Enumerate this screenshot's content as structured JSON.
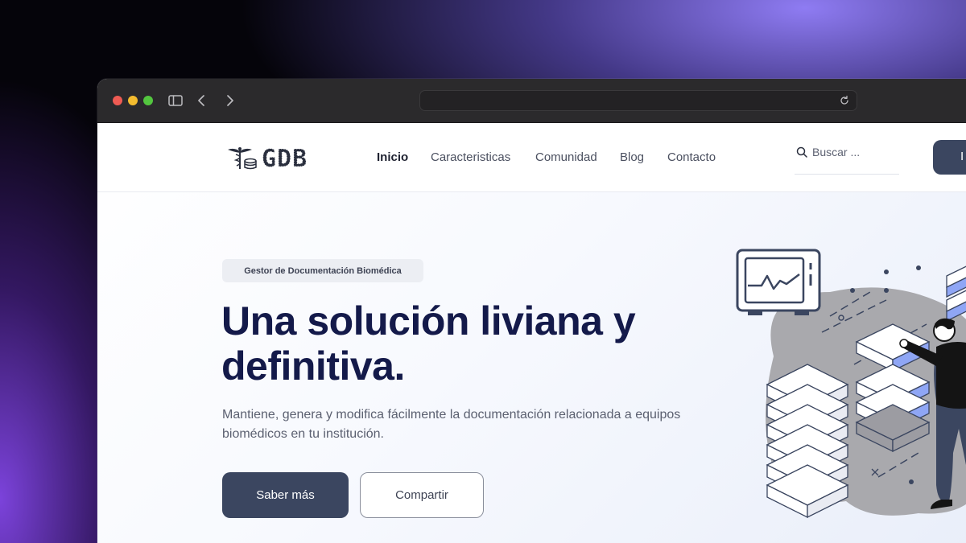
{
  "browser": {
    "url_text": ""
  },
  "nav": {
    "logo_text": "GDB",
    "links": [
      "Inicio",
      "Caracteristicas",
      "Comunidad",
      "Blog",
      "Contacto"
    ],
    "search_placeholder": "Buscar ...",
    "login_label": "I"
  },
  "hero": {
    "badge": "Gestor de Documentación Biomédica",
    "headline": "Una solución liviana y definitiva.",
    "description": "Mantiene, genera y modifica fácilmente la documentación relacionada a equipos biomédicos en tu institución.",
    "primary_button": "Saber más",
    "secondary_button": "Compartir"
  },
  "icons": [
    "sidebar-icon",
    "back-icon",
    "forward-icon",
    "reload-icon",
    "search-icon",
    "caduceus-icon"
  ],
  "colors": {
    "primary": "#3b4660",
    "headline": "#141a4a",
    "illustration_blob": "#a9a9ad",
    "illustration_accent": "#8fa6f5"
  }
}
